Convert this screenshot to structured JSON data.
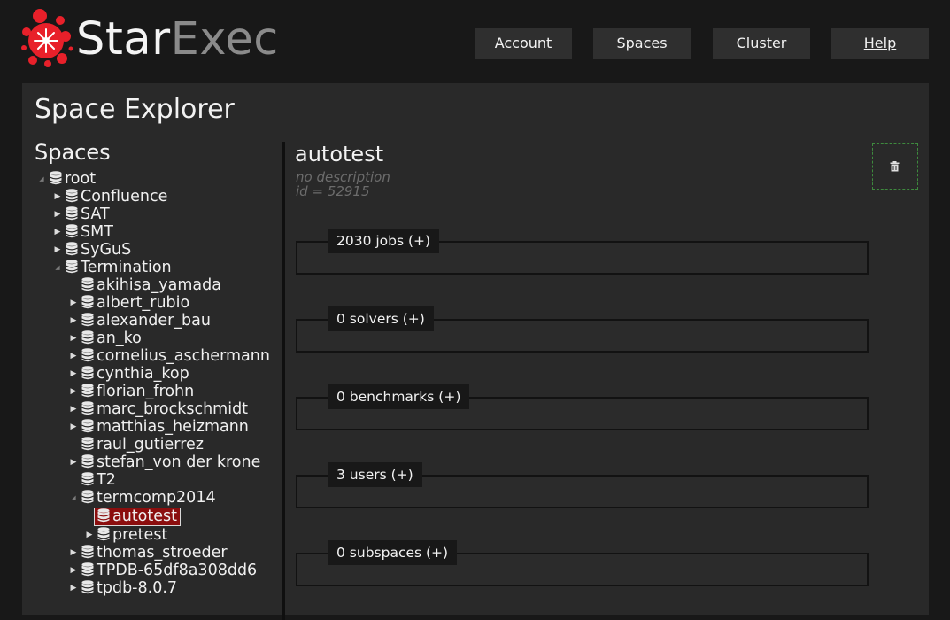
{
  "header": {
    "logo_star": "Star",
    "logo_exec": "Exec",
    "nav": [
      {
        "label": "Account"
      },
      {
        "label": "Spaces"
      },
      {
        "label": "Cluster"
      },
      {
        "label": "Help"
      }
    ]
  },
  "page": {
    "title": "Space Explorer",
    "spaces_heading": "Spaces"
  },
  "tree": [
    {
      "label": "root",
      "arrow": "open"
    },
    {
      "label": "Confluence",
      "arrow": "closed"
    },
    {
      "label": "SAT",
      "arrow": "closed"
    },
    {
      "label": "SMT",
      "arrow": "closed"
    },
    {
      "label": "SyGuS",
      "arrow": "closed"
    },
    {
      "label": "Termination",
      "arrow": "open"
    },
    {
      "label": "akihisa_yamada",
      "arrow": "none"
    },
    {
      "label": "albert_rubio",
      "arrow": "closed"
    },
    {
      "label": "alexander_bau",
      "arrow": "closed"
    },
    {
      "label": "an_ko",
      "arrow": "closed"
    },
    {
      "label": "cornelius_aschermann",
      "arrow": "closed"
    },
    {
      "label": "cynthia_kop",
      "arrow": "closed"
    },
    {
      "label": "florian_frohn",
      "arrow": "closed"
    },
    {
      "label": "marc_brockschmidt",
      "arrow": "closed"
    },
    {
      "label": "matthias_heizmann",
      "arrow": "closed"
    },
    {
      "label": "raul_gutierrez",
      "arrow": "none"
    },
    {
      "label": "stefan_von der krone",
      "arrow": "closed"
    },
    {
      "label": "T2",
      "arrow": "none"
    },
    {
      "label": "termcomp2014",
      "arrow": "open"
    },
    {
      "label": "autotest",
      "arrow": "none",
      "selected": true
    },
    {
      "label": "pretest",
      "arrow": "closed"
    },
    {
      "label": "thomas_stroeder",
      "arrow": "closed"
    },
    {
      "label": "TPDB-65df8a308dd6",
      "arrow": "closed"
    },
    {
      "label": "tpdb-8.0.7",
      "arrow": "closed"
    }
  ],
  "details": {
    "name": "autotest",
    "description": "no description",
    "id_text": "id = 52915"
  },
  "sections": [
    {
      "label": "2030 jobs (+)"
    },
    {
      "label": "0 solvers (+)"
    },
    {
      "label": "0 benchmarks (+)"
    },
    {
      "label": "3 users (+)"
    },
    {
      "label": "0 subspaces (+)"
    }
  ],
  "colors": {
    "background": "#181818",
    "panel": "#292929",
    "selected": "#8b0e0e",
    "logo_red": "#e8202a"
  },
  "icons": {
    "tree_node": "database-icon",
    "delete": "trash-icon",
    "logo": "starburst-logo-icon"
  }
}
